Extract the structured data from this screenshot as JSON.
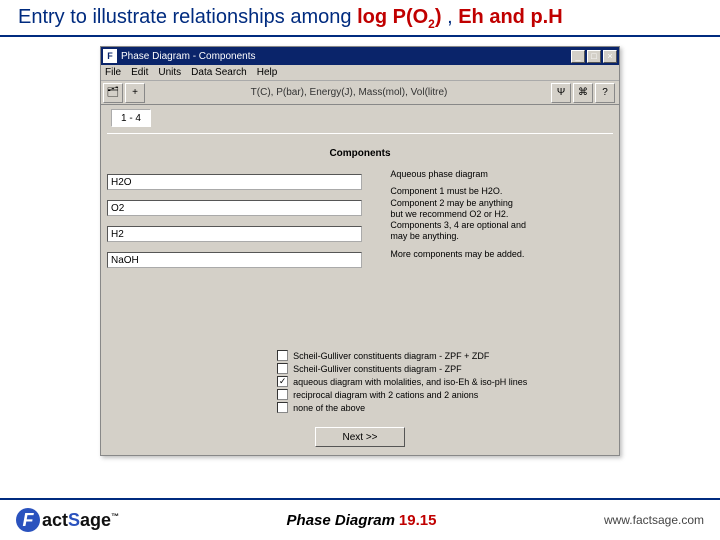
{
  "slide": {
    "title_prefix": "Entry to illustrate relationships among ",
    "title_hl_1": "log P(O",
    "title_hl_1_sub": "2",
    "title_hl_1_tail": ")",
    "title_mid": ", ",
    "title_hl_2": "Eh and p.H"
  },
  "window": {
    "icon_letter": "F",
    "title": "Phase Diagram - Components",
    "menus": [
      "File",
      "Edit",
      "Units",
      "Data Search",
      "Help"
    ],
    "toolbar_label": "T(C), P(bar), Energy(J), Mass(mol), Vol(litre)",
    "toolbar_icons": {
      "open": "🗂",
      "plus": "+",
      "a": "Ψ",
      "b": "⌘",
      "c": "?"
    },
    "count": "1 - 4"
  },
  "components": {
    "heading": "Components",
    "fields": [
      "H2O",
      "O2",
      "H2",
      "NaOH"
    ]
  },
  "info": {
    "p1": "Aqueous phase diagram",
    "p2": "Component 1 must be H2O.\nComponent 2 may be anything\n  but we recommend O2 or H2.\nComponents 3, 4 are optional and\n may be anything.",
    "p3": "More components may be added."
  },
  "options": [
    {
      "checked": false,
      "label": "Scheil-Gulliver constituents diagram - ZPF + ZDF"
    },
    {
      "checked": false,
      "label": "Scheil-Gulliver constituents diagram - ZPF"
    },
    {
      "checked": true,
      "label": "aqueous diagram with molalities, and iso-Eh & iso-pH lines"
    },
    {
      "checked": false,
      "label": "reciprocal diagram with 2 cations and 2 anions"
    },
    {
      "checked": false,
      "label": "none of the above"
    }
  ],
  "buttons": {
    "next": "Next >>"
  },
  "footer": {
    "logo_f": "F",
    "logo_rest_a": "act",
    "logo_rest_b": "S",
    "logo_rest_c": "age",
    "tm": "™",
    "caption": "Phase Diagram",
    "number": "19.15",
    "url": "www.factsage.com"
  }
}
